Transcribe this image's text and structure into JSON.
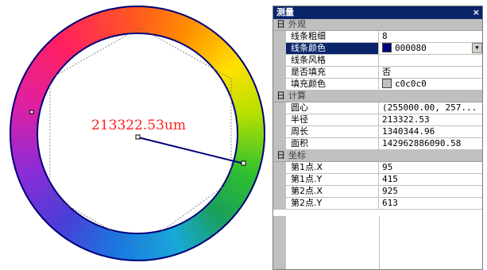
{
  "canvas": {
    "measurement_text": "213322.53um",
    "line_color": "#00007a",
    "text_color": "#ff2020"
  },
  "panel": {
    "title": "测量",
    "close_symbol": "×",
    "collapse_symbol": "日",
    "sections": [
      {
        "label": "外观",
        "rows": [
          {
            "name": "线条粗细",
            "value": "8"
          },
          {
            "name": "线条颜色",
            "value": "000080",
            "swatch": "#000080",
            "selected": true,
            "dropdown": true
          },
          {
            "name": "线条风格",
            "value": ""
          },
          {
            "name": "是否填充",
            "value": "否"
          },
          {
            "name": "填充颜色",
            "value": "c0c0c0",
            "swatch": "#c0c0c0"
          }
        ]
      },
      {
        "label": "计算",
        "rows": [
          {
            "name": "圆心",
            "value": "(255000.00, 257..."
          },
          {
            "name": "半径",
            "value": "213322.53"
          },
          {
            "name": "周长",
            "value": "1340344.96"
          },
          {
            "name": "面积",
            "value": "142962886090.58"
          }
        ]
      },
      {
        "label": "坐标",
        "rows": [
          {
            "name": "第1点.X",
            "value": "95"
          },
          {
            "name": "第1点.Y",
            "value": "415"
          },
          {
            "name": "第2点.X",
            "value": "925"
          },
          {
            "name": "第2点.Y",
            "value": "613"
          }
        ]
      }
    ]
  }
}
